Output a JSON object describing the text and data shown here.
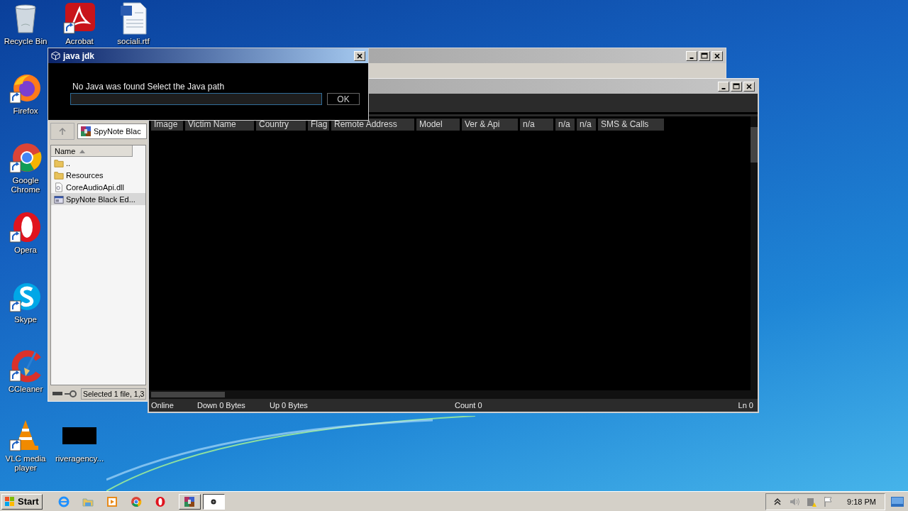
{
  "desktop": {
    "icons": [
      {
        "label": "Recycle Bin",
        "kind": "recycle",
        "shortcut": false
      },
      {
        "label": "Acrobat",
        "kind": "acrobat",
        "shortcut": true
      },
      {
        "label": "sociali.rtf",
        "kind": "document",
        "shortcut": false
      },
      {
        "label": "Firefox",
        "kind": "firefox",
        "shortcut": true
      },
      {
        "label": "Google Chrome",
        "kind": "chrome",
        "shortcut": true
      },
      {
        "label": "Opera",
        "kind": "opera",
        "shortcut": true
      },
      {
        "label": "Skype",
        "kind": "skype",
        "shortcut": true
      },
      {
        "label": "CCleaner",
        "kind": "ccleaner",
        "shortcut": true
      },
      {
        "label": "VLC media player",
        "kind": "vlc",
        "shortcut": true
      },
      {
        "label": "riveragency...",
        "kind": "blank",
        "shortcut": false
      }
    ]
  },
  "explorer": {
    "address": "SpyNote Blac",
    "column": "Name",
    "items": [
      {
        "name": "..",
        "kind": "folder",
        "selected": false
      },
      {
        "name": "Resources",
        "kind": "folder",
        "selected": false
      },
      {
        "name": "CoreAudioApi.dll",
        "kind": "dll",
        "selected": false
      },
      {
        "name": "SpyNote Black Ed...",
        "kind": "app",
        "selected": true
      }
    ],
    "status": "Selected 1 file, 1,3"
  },
  "spynote": {
    "columns": [
      "Image",
      "Victim Name",
      "Country",
      "Flag",
      "Remote Address",
      "Model",
      "Ver & Api",
      "n/a",
      "n/a",
      "n/a",
      "SMS & Calls"
    ],
    "status_bar": {
      "connection": "Online",
      "down": "Down 0 Bytes",
      "up": "Up 0 Bytes",
      "count": "Count 0",
      "line": "Ln 0"
    }
  },
  "dialog": {
    "title": "java jdk",
    "message": "No Java was found Select the Java path",
    "button": "OK"
  },
  "taskbar": {
    "start": "Start",
    "tasks": [
      {
        "kind": "winrar",
        "selected": false
      },
      {
        "kind": "app",
        "selected": true
      }
    ],
    "clock": "9:18 PM"
  }
}
